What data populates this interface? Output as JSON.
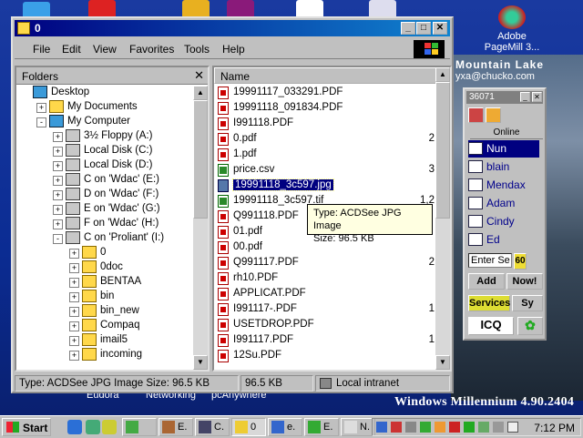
{
  "colors": {
    "title_active": "#000080",
    "selection": "#000080",
    "tooltip_bg": "#ffffe1"
  },
  "desktop": {
    "top_left_captions": [
      "Eudora",
      "Networking",
      "pcAnywhere"
    ],
    "adobe_label_line1": "Adobe",
    "adobe_label_line2": "PageMill 3...",
    "scenic_title": "Mountain Lake",
    "scenic_sub": "yxa@chucko.com",
    "watermark": "Windows Millennium 4.90.2404"
  },
  "window": {
    "title": "0",
    "menus": [
      "File",
      "Edit",
      "View",
      "Favorites",
      "Tools",
      "Help"
    ],
    "folders_header": "Folders",
    "tree": [
      {
        "label": "Desktop",
        "icon": "desktop-icon",
        "indent": 0,
        "pm": ""
      },
      {
        "label": "My Documents",
        "icon": "folder-icon",
        "indent": 1,
        "pm": "+"
      },
      {
        "label": "My Computer",
        "icon": "computer-icon",
        "indent": 1,
        "pm": "-"
      },
      {
        "label": "3½ Floppy (A:)",
        "icon": "floppy-icon",
        "indent": 2,
        "pm": "+"
      },
      {
        "label": "Local Disk (C:)",
        "icon": "drive-icon",
        "indent": 2,
        "pm": "+"
      },
      {
        "label": "Local Disk (D:)",
        "icon": "drive-icon",
        "indent": 2,
        "pm": "+"
      },
      {
        "label": "C on 'Wdac' (E:)",
        "icon": "network-drive-icon",
        "indent": 2,
        "pm": "+"
      },
      {
        "label": "D on 'Wdac' (F:)",
        "icon": "network-drive-icon",
        "indent": 2,
        "pm": "+"
      },
      {
        "label": "E on 'Wdac' (G:)",
        "icon": "network-drive-icon",
        "indent": 2,
        "pm": "+"
      },
      {
        "label": "F on 'Wdac' (H:)",
        "icon": "network-drive-icon",
        "indent": 2,
        "pm": "+"
      },
      {
        "label": "C on 'Proliant' (I:)",
        "icon": "network-drive-icon",
        "indent": 2,
        "pm": "-"
      },
      {
        "label": "0",
        "icon": "folder-icon",
        "indent": 3,
        "pm": "+"
      },
      {
        "label": "0doc",
        "icon": "folder-icon",
        "indent": 3,
        "pm": "+"
      },
      {
        "label": "BENTAA",
        "icon": "folder-icon",
        "indent": 3,
        "pm": "+"
      },
      {
        "label": "bin",
        "icon": "folder-icon",
        "indent": 3,
        "pm": "+"
      },
      {
        "label": "bin_new",
        "icon": "folder-icon",
        "indent": 3,
        "pm": "+"
      },
      {
        "label": "Compaq",
        "icon": "folder-icon",
        "indent": 3,
        "pm": "+"
      },
      {
        "label": "imail5",
        "icon": "folder-icon",
        "indent": 3,
        "pm": "+"
      },
      {
        "label": "incoming",
        "icon": "folder-icon",
        "indent": 3,
        "pm": "+"
      }
    ],
    "list_header": "Name",
    "files": [
      {
        "name": "19991117_033291.PDF",
        "type": "pdf",
        "size": ""
      },
      {
        "name": "19991118_091834.PDF",
        "type": "pdf",
        "size": ""
      },
      {
        "name": "I991118.PDF",
        "type": "pdf",
        "size": ""
      },
      {
        "name": "0.pdf",
        "type": "pdf",
        "size": "2"
      },
      {
        "name": "1.pdf",
        "type": "pdf",
        "size": ""
      },
      {
        "name": "price.csv",
        "type": "csv",
        "size": "3"
      },
      {
        "name": "19991118_3c597.jpg",
        "type": "jpg",
        "size": "",
        "selected": true
      },
      {
        "name": "19991118_3c597.tif",
        "type": "csv",
        "size": "1,2"
      },
      {
        "name": "Q991118.PDF",
        "type": "pdf",
        "size": ""
      },
      {
        "name": "01.pdf",
        "type": "pdf",
        "size": ""
      },
      {
        "name": "00.pdf",
        "type": "pdf",
        "size": ""
      },
      {
        "name": "Q991117.PDF",
        "type": "pdf",
        "size": "2"
      },
      {
        "name": "rh10.PDF",
        "type": "pdf",
        "size": ""
      },
      {
        "name": "APPLICAT.PDF",
        "type": "pdf",
        "size": ""
      },
      {
        "name": "I991117-.PDF",
        "type": "pdf",
        "size": "1"
      },
      {
        "name": "USETDROP.PDF",
        "type": "pdf",
        "size": ""
      },
      {
        "name": "I991117.PDF",
        "type": "pdf",
        "size": "1"
      },
      {
        "name": "12Su.PDF",
        "type": "pdf",
        "size": ""
      }
    ],
    "tooltip_line1": "Type: ACDSee JPG Image",
    "tooltip_line2": "Size: 96.5 KB",
    "status_main": "Type: ACDSee JPG Image Size: 96.5 KB",
    "status_size": "96.5 KB",
    "status_zone": "Local intranet"
  },
  "icq": {
    "uin": "36071",
    "online_label": "Online",
    "contacts": [
      {
        "name": "Nun",
        "highlight": true
      },
      {
        "name": "blain",
        "highlight": false
      },
      {
        "name": "Mendax",
        "highlight": false
      },
      {
        "name": "Adam",
        "highlight": false
      },
      {
        "name": "Cindy",
        "highlight": false
      },
      {
        "name": "Ed",
        "highlight": false
      }
    ],
    "search_placeholder": "Enter Se",
    "badge": "60",
    "add_label": "Add",
    "now_label": "Now!",
    "services_label": "Services",
    "sy_label": "Sy",
    "logo_label": "ICQ"
  },
  "taskbar": {
    "start_label": "Start",
    "tasks": [
      {
        "label": "",
        "icon": "clock-icon"
      },
      {
        "label": "E.",
        "icon": "tools-icon"
      },
      {
        "label": "C.",
        "icon": "console-icon"
      },
      {
        "label": "0",
        "icon": "explorer-icon",
        "active": true
      },
      {
        "label": "e.",
        "icon": "ie-icon"
      },
      {
        "label": "E.",
        "icon": "excel-icon"
      },
      {
        "label": "N.",
        "icon": "notepad-icon"
      }
    ],
    "clock": "7:12 PM"
  }
}
